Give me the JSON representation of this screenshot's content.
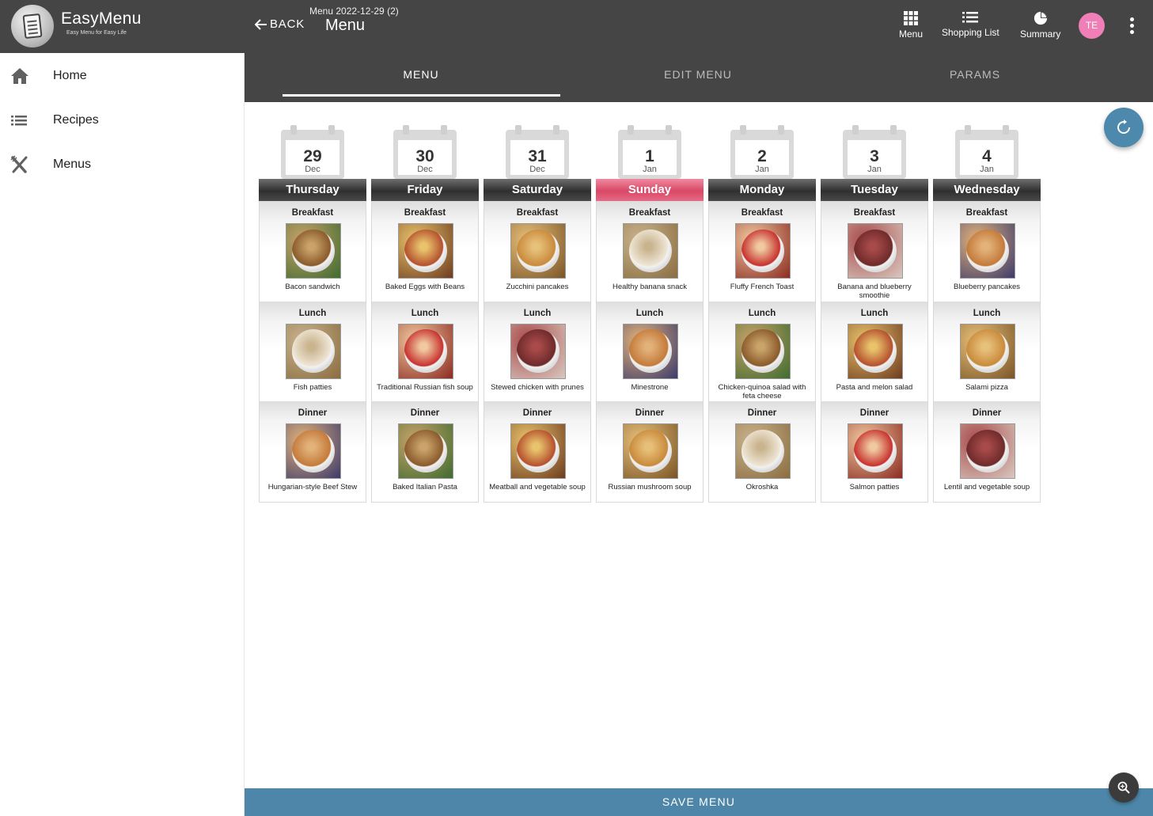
{
  "app": {
    "brand": "EasyMenu",
    "tagline": "Easy Menu for Easy Life",
    "back_label": "BACK",
    "breadcrumb": "Menu 2022-12-29 (2)",
    "page_title": "Menu"
  },
  "topbar": {
    "menu_label": "Menu",
    "shopping_label": "Shopping List",
    "summary_label": "Summary",
    "avatar_initials": "TE"
  },
  "sidebar": {
    "items": [
      {
        "label": "Home",
        "icon": "home-icon"
      },
      {
        "label": "Recipes",
        "icon": "list-icon"
      },
      {
        "label": "Menus",
        "icon": "utensils-icon"
      }
    ]
  },
  "tabs": [
    {
      "label": "MENU",
      "active": true
    },
    {
      "label": "EDIT MENU",
      "active": false
    },
    {
      "label": "PARAMS",
      "active": false
    }
  ],
  "meal_types": [
    "Breakfast",
    "Lunch",
    "Dinner"
  ],
  "days": [
    {
      "day": "29",
      "month": "Dec",
      "weekday": "Thursday",
      "highlight": false,
      "meals": [
        "Bacon sandwich",
        "Fish patties",
        "Hungarian-style Beef Stew"
      ]
    },
    {
      "day": "30",
      "month": "Dec",
      "weekday": "Friday",
      "highlight": false,
      "meals": [
        "Baked Eggs with Beans",
        "Traditional Russian fish soup",
        "Baked Italian Pasta"
      ]
    },
    {
      "day": "31",
      "month": "Dec",
      "weekday": "Saturday",
      "highlight": false,
      "meals": [
        "Zucchini pancakes",
        "Stewed chicken with prunes",
        "Meatball and vegetable soup"
      ]
    },
    {
      "day": "1",
      "month": "Jan",
      "weekday": "Sunday",
      "highlight": true,
      "meals": [
        "Healthy banana snack",
        "Minestrone",
        "Russian mushroom soup"
      ]
    },
    {
      "day": "2",
      "month": "Jan",
      "weekday": "Monday",
      "highlight": false,
      "meals": [
        "Fluffy French Toast",
        "Chicken-quinoa salad with feta cheese",
        "Okroshka"
      ]
    },
    {
      "day": "3",
      "month": "Jan",
      "weekday": "Tuesday",
      "highlight": false,
      "meals": [
        "Banana and blueberry smoothie",
        "Pasta and melon salad",
        "Salmon patties"
      ]
    },
    {
      "day": "4",
      "month": "Jan",
      "weekday": "Wednesday",
      "highlight": false,
      "meals": [
        "Blueberry pancakes",
        "Salami pizza",
        "Lentil and vegetable soup"
      ]
    }
  ],
  "save_label": "SAVE MENU",
  "colors": {
    "appbar": "#454545",
    "accent": "#4d86a8",
    "sunday": "#d94866",
    "avatar": "#ef7fb6"
  }
}
